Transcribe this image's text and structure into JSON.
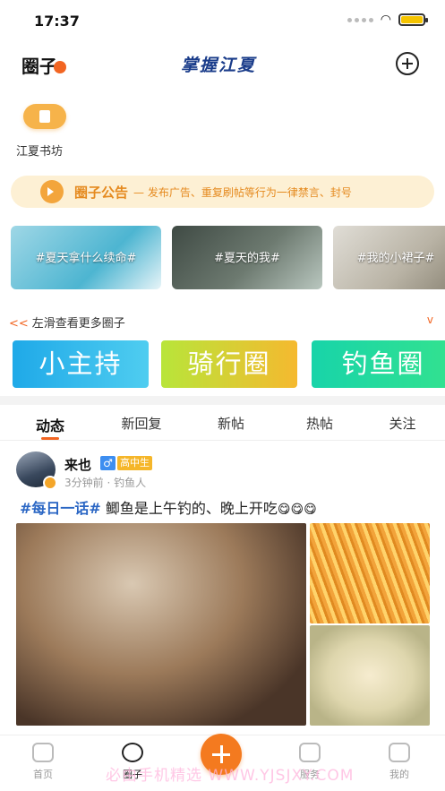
{
  "status_bar": {
    "time": "17:37"
  },
  "header": {
    "title": "圈子",
    "brand": "掌握江夏"
  },
  "circle_entry": {
    "label": "江夏书坊"
  },
  "notice": {
    "title": "圈子公告",
    "message": "— 发布广告、重复刷帖等行为一律禁言、封号"
  },
  "topics": [
    "#夏天拿什么续命#",
    "#夏天的我#",
    "#我的小裙子#"
  ],
  "slide_hint": {
    "text": "左滑查看更多圈子",
    "arrow": "<<",
    "expand": "v"
  },
  "circles": [
    "小主持",
    "骑行圈",
    "钓鱼圈"
  ],
  "tabs": [
    "动态",
    "新回复",
    "新帖",
    "热帖",
    "关注"
  ],
  "active_tab": "动态",
  "post": {
    "username": "来也",
    "gender": "♂",
    "level": "高中生",
    "meta": "3分钟前 · 钓鱼人",
    "tag": "#每日一话#",
    "text": " 鲫鱼是上午钓的、晚上开吃",
    "emoji": "😋😋😋"
  },
  "bottom_nav": {
    "home": "首页",
    "circle": "圈子",
    "service": "服务",
    "mine": "我的"
  },
  "watermark": "必由手机精选 WWW.YJSJXY.COM",
  "colors": {
    "accent": "#f26522",
    "fab": "#f47a1f",
    "tag": "#2a66c4",
    "notice_bg": "#fdf0d4"
  }
}
